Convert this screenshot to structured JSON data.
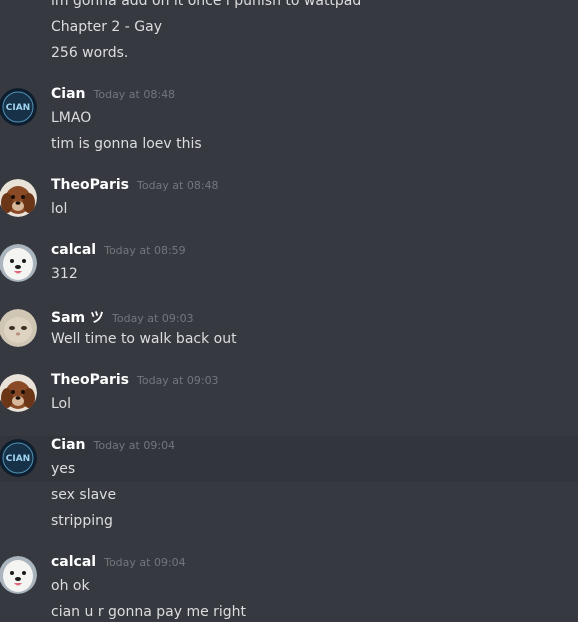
{
  "messages": {
    "top": {
      "line0": "im gonna add on it once i punish to wattpad",
      "line1": "Chapter 2 - Gay",
      "line2": "256 words."
    },
    "m1": {
      "author": "Cian",
      "timestamp": "Today at 08:48",
      "line0": "LMAO",
      "line1": "tim is gonna loev this",
      "avatar": "cian-logo-avatar"
    },
    "m2": {
      "author": "TheoParis",
      "timestamp": "Today at 08:48",
      "line0": "lol",
      "avatar": "brown-puppy-avatar"
    },
    "m3": {
      "author": "calcal",
      "timestamp": "Today at 08:59",
      "line0": "312",
      "avatar": "white-dog-avatar"
    },
    "m4": {
      "author": "Sam ツ",
      "timestamp": "Today at 09:03",
      "line0": "Well time to walk back out",
      "avatar": "cat-avatar"
    },
    "m5": {
      "author": "TheoParis",
      "timestamp": "Today at 09:03",
      "line0": "Lol",
      "avatar": "brown-puppy-avatar"
    },
    "m6": {
      "author": "Cian",
      "timestamp": "Today at 09:04",
      "line0": "yes",
      "line1": "sex slave",
      "line2": "stripping",
      "avatar": "cian-logo-avatar"
    },
    "m7": {
      "author": "calcal",
      "timestamp": "Today at 09:04",
      "line0": "oh ok",
      "line1": "cian u r gonna pay me right",
      "avatar": "white-dog-avatar"
    }
  },
  "colors": {
    "background": "#36393f",
    "hover": "#32353b",
    "username": "#ffffff",
    "timestamp": "#72767d",
    "text": "#dcddde"
  }
}
